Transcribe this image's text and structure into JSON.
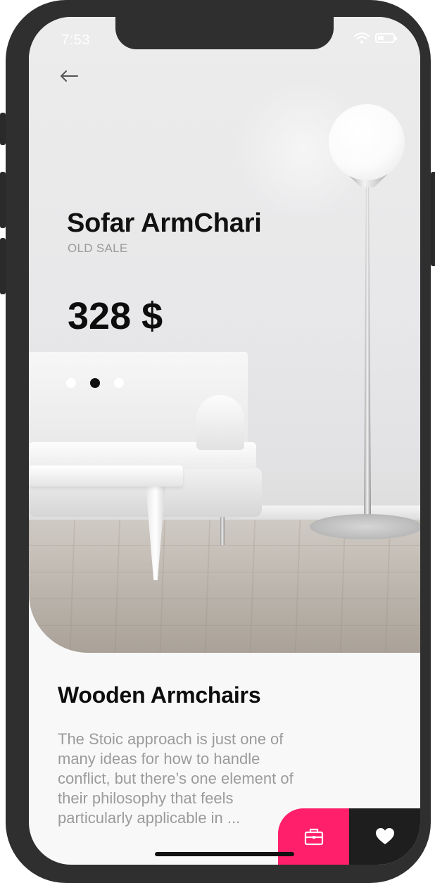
{
  "status_bar": {
    "time": "7:53"
  },
  "header": {
    "back_icon": "arrow-left-icon"
  },
  "product": {
    "title": "Sofar ArmChari",
    "subtitle": "OLD SALE",
    "price": "328 $",
    "carousel": {
      "count": 3,
      "active_index": 1
    }
  },
  "details": {
    "title": "Wooden Armchairs",
    "description": "The Stoic approach is just one of many ideas for how to handle conflict, but there’s one element of their philosophy that feels particularly applicable in ..."
  },
  "actions": {
    "cart_icon": "briefcase-icon",
    "favorite_icon": "heart-icon"
  },
  "colors": {
    "accent": "#ff1f6b",
    "dark_button": "#1e1e1e",
    "device_frame": "#2f2f2f"
  }
}
